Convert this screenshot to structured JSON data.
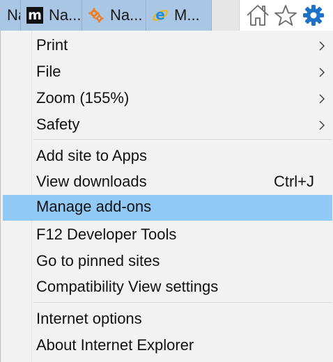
{
  "tabs": [
    {
      "title": "Na",
      "favicon": "none",
      "active": false
    },
    {
      "title": "Na...",
      "favicon": "m-logo",
      "active": false
    },
    {
      "title": "Na...",
      "favicon": "orange-cogs-icon",
      "active": false
    },
    {
      "title": "M...",
      "favicon": "ie-logo-icon",
      "active": false
    }
  ],
  "toolbar": {
    "home_icon": "home-icon",
    "favorites_icon": "star-icon",
    "tools_icon": "gear-icon"
  },
  "favicon_m_letter": "m",
  "menu": {
    "groups": [
      [
        {
          "label": "Print",
          "submenu": true
        },
        {
          "label": "File",
          "submenu": true
        },
        {
          "label": "Zoom (155%)",
          "submenu": true
        },
        {
          "label": "Safety",
          "submenu": true
        }
      ],
      [
        {
          "label": "Add site to Apps"
        },
        {
          "label": "View downloads",
          "shortcut": "Ctrl+J"
        },
        {
          "label": "Manage add-ons",
          "highlighted": true
        },
        {
          "label": "F12 Developer Tools"
        },
        {
          "label": "Go to pinned sites"
        },
        {
          "label": "Compatibility View settings"
        }
      ],
      [
        {
          "label": "Internet options"
        },
        {
          "label": "About Internet Explorer"
        }
      ]
    ]
  },
  "colors": {
    "tab_bg": "#a9c6e4",
    "menu_bg": "#f2f2f2",
    "highlight": "#91c9f7",
    "gear_blue": "#1e73c8"
  }
}
